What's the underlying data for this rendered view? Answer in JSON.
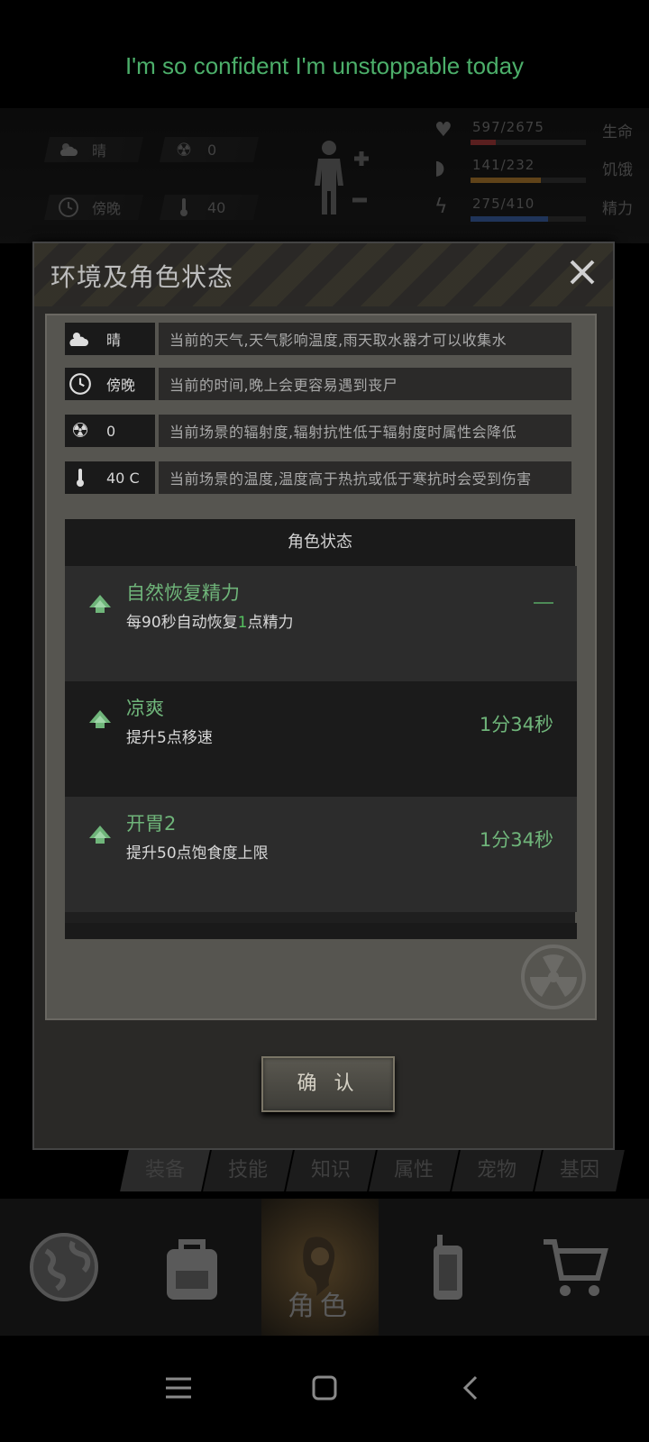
{
  "banner": {
    "text": "I'm so confident I'm unstoppable today"
  },
  "hud": {
    "weather": "晴",
    "radiation": "0",
    "time": "傍晚",
    "temperature": "40",
    "vitals": [
      {
        "value": "597/2675",
        "label": "生命",
        "fraction": 0.22,
        "color": "#a33a3a",
        "icon": "heart-icon"
      },
      {
        "value": "141/232",
        "label": "饥饿",
        "fraction": 0.61,
        "color": "#b07a2e",
        "icon": "stomach-icon"
      },
      {
        "value": "275/410",
        "label": "精力",
        "fraction": 0.67,
        "color": "#3a5fa3",
        "icon": "energy-icon"
      }
    ]
  },
  "dialog": {
    "title": "环境及角色状态",
    "env": [
      {
        "icon": "weather-icon",
        "key": "晴",
        "desc": "当前的天气,天气影响温度,雨天取水器才可以收集水"
      },
      {
        "icon": "clock-icon",
        "key": "傍晚",
        "desc": "当前的时间,晚上会更容易遇到丧尸"
      },
      {
        "icon": "radiation-icon",
        "key": "0",
        "desc": "当前场景的辐射度,辐射抗性低于辐射度时属性会降低"
      },
      {
        "icon": "thermometer-icon",
        "key": "40 C",
        "desc": "当前场景的温度,温度高于热抗或低于寒抗时会受到伤害"
      }
    ],
    "status_header": "角色状态",
    "statuses": [
      {
        "name": "自然恢复精力",
        "desc_before": "每90秒自动恢复",
        "desc_highlight": "1",
        "desc_after": "点精力",
        "time": ""
      },
      {
        "name": "凉爽",
        "desc": "提升5点移速",
        "time": "1分34秒"
      },
      {
        "name": "开胃2",
        "desc": "提升50点饱食度上限",
        "time": "1分34秒"
      }
    ],
    "confirm": "确 认"
  },
  "subtabs": [
    "装备",
    "技能",
    "知识",
    "属性",
    "宠物",
    "基因"
  ],
  "bottomnav": {
    "active_label": "角色"
  },
  "colors": {
    "accent_green": "#6fb57a",
    "banner_green": "#4caf6a"
  }
}
